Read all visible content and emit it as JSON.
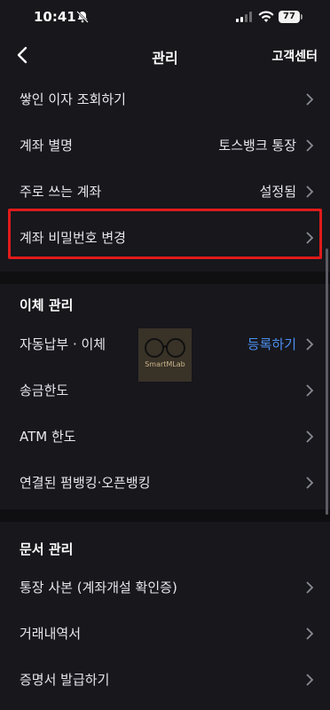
{
  "status_bar": {
    "time": "10:41",
    "battery": "77"
  },
  "nav": {
    "title": "관리",
    "action": "고객센터"
  },
  "rows_top": [
    {
      "label": "쌓인 이자 조회하기",
      "value": ""
    },
    {
      "label": "계좌 별명",
      "value": "토스뱅크 통장"
    },
    {
      "label": "주로 쓰는 계좌",
      "value": "설정됨"
    },
    {
      "label": "계좌 비밀번호 변경",
      "value": ""
    }
  ],
  "sections": [
    {
      "title": "이체 관리",
      "rows": [
        {
          "label": "자동납부 · 이체",
          "value": "등록하기"
        },
        {
          "label": "송금한도",
          "value": ""
        },
        {
          "label": "ATM 한도",
          "value": ""
        },
        {
          "label": "연결된 펌뱅킹·오픈뱅킹",
          "value": ""
        }
      ]
    },
    {
      "title": "문서 관리",
      "rows": [
        {
          "label": "통장 사본 (계좌개설 확인증)",
          "value": ""
        },
        {
          "label": "거래내역서",
          "value": ""
        },
        {
          "label": "증명서 발급하기",
          "value": ""
        }
      ]
    }
  ],
  "watermark": {
    "text": "SmartMLab"
  },
  "colors": {
    "background": "#17171c",
    "accent": "#4b8ff0",
    "highlight": "#e01b1b"
  }
}
